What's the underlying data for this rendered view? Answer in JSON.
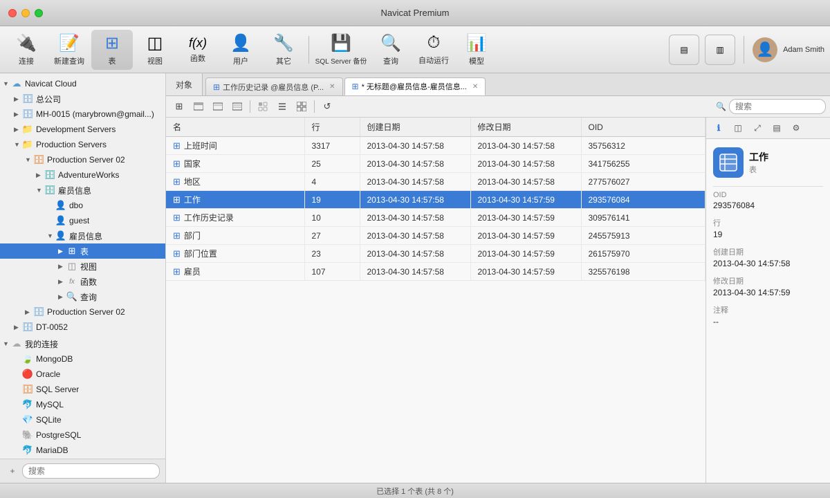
{
  "app": {
    "title": "Navicat Premium"
  },
  "toolbar": {
    "buttons": [
      {
        "id": "connect",
        "label": "连接",
        "icon": "🔌"
      },
      {
        "id": "new-query",
        "label": "新建查询",
        "icon": "📄"
      },
      {
        "id": "table",
        "label": "表",
        "icon": "⊞",
        "active": true
      },
      {
        "id": "view",
        "label": "视图",
        "icon": "◫"
      },
      {
        "id": "func",
        "label": "函数",
        "icon": "fx"
      },
      {
        "id": "user",
        "label": "用户",
        "icon": "👤"
      },
      {
        "id": "other",
        "label": "其它",
        "icon": "🔧"
      },
      {
        "id": "sqlserver-backup",
        "label": "SQL Server 备份",
        "icon": "💾"
      },
      {
        "id": "query",
        "label": "查询",
        "icon": "🔍"
      },
      {
        "id": "auto-run",
        "label": "自动运行",
        "icon": "⚡"
      },
      {
        "id": "model",
        "label": "模型",
        "icon": "📊"
      }
    ],
    "view_buttons": [
      {
        "id": "view1",
        "icon": "▤"
      },
      {
        "id": "view2",
        "icon": "▥"
      }
    ],
    "user": {
      "name": "Adam Smith",
      "avatar_bg": "#c0a080"
    }
  },
  "tabs_label": "对象",
  "tabs": [
    {
      "id": "tab-history",
      "label": "工作历史记录 @雇员信息 (P...",
      "icon": "⊞",
      "active": false,
      "closeable": true
    },
    {
      "id": "tab-untitled",
      "label": "* 无标题@雇员信息-雇员信息...",
      "icon": "⊞",
      "active": true,
      "closeable": true
    }
  ],
  "subtoolbar": {
    "buttons": [
      {
        "id": "btn-grid",
        "icon": "⊞"
      },
      {
        "id": "btn-add",
        "icon": "+"
      },
      {
        "id": "btn-remove",
        "icon": "−"
      },
      {
        "id": "btn-edit",
        "icon": "✏"
      },
      {
        "id": "btn-form",
        "icon": "▦"
      },
      {
        "id": "btn-refresh2",
        "icon": "↺"
      },
      {
        "id": "btn-filter2",
        "icon": "⊟"
      }
    ],
    "refresh_icon": "↺",
    "search_placeholder": "搜索"
  },
  "table": {
    "columns": [
      {
        "id": "name",
        "label": "名"
      },
      {
        "id": "rows",
        "label": "行"
      },
      {
        "id": "created",
        "label": "创建日期"
      },
      {
        "id": "modified",
        "label": "修改日期"
      },
      {
        "id": "oid",
        "label": "OID"
      }
    ],
    "rows": [
      {
        "name": "上班时间",
        "rows": "3317",
        "created": "2013-04-30 14:57:58",
        "modified": "2013-04-30 14:57:58",
        "oid": "35756312",
        "selected": false
      },
      {
        "name": "国家",
        "rows": "25",
        "created": "2013-04-30 14:57:58",
        "modified": "2013-04-30 14:57:58",
        "oid": "341756255",
        "selected": false
      },
      {
        "name": "地区",
        "rows": "4",
        "created": "2013-04-30 14:57:58",
        "modified": "2013-04-30 14:57:58",
        "oid": "277576027",
        "selected": false
      },
      {
        "name": "工作",
        "rows": "19",
        "created": "2013-04-30 14:57:58",
        "modified": "2013-04-30 14:57:59",
        "oid": "293576084",
        "selected": true
      },
      {
        "name": "工作历史记录",
        "rows": "10",
        "created": "2013-04-30 14:57:58",
        "modified": "2013-04-30 14:57:59",
        "oid": "309576141",
        "selected": false
      },
      {
        "name": "部门",
        "rows": "27",
        "created": "2013-04-30 14:57:58",
        "modified": "2013-04-30 14:57:59",
        "oid": "245575913",
        "selected": false
      },
      {
        "name": "部门位置",
        "rows": "23",
        "created": "2013-04-30 14:57:58",
        "modified": "2013-04-30 14:57:59",
        "oid": "261575970",
        "selected": false
      },
      {
        "name": "雇员",
        "rows": "107",
        "created": "2013-04-30 14:57:58",
        "modified": "2013-04-30 14:57:59",
        "oid": "325576198",
        "selected": false
      }
    ]
  },
  "right_panel": {
    "tabs": [
      {
        "id": "info",
        "label": "ℹ",
        "active": true
      },
      {
        "id": "preview",
        "label": "◫"
      },
      {
        "id": "expand",
        "label": "⤢"
      },
      {
        "id": "cols",
        "label": "▤"
      },
      {
        "id": "settings",
        "label": "⚙"
      }
    ],
    "object": {
      "name": "工作",
      "type": "表"
    },
    "fields": [
      {
        "label": "OID",
        "value": "293576084"
      },
      {
        "label": "行",
        "value": "19"
      },
      {
        "label": "创建日期",
        "value": "2013-04-30 14:57:58"
      },
      {
        "label": "修改日期",
        "value": "2013-04-30 14:57:59"
      },
      {
        "label": "注释",
        "value": "--"
      }
    ]
  },
  "sidebar": {
    "search_placeholder": "搜索",
    "tree": [
      {
        "id": "navicat-cloud",
        "label": "Navicat Cloud",
        "icon": "cloud",
        "level": 0,
        "expanded": true,
        "arrow": "open"
      },
      {
        "id": "corp",
        "label": "总公司",
        "icon": "db",
        "level": 1,
        "expanded": false,
        "arrow": "closed"
      },
      {
        "id": "mh-0015",
        "label": "MH-0015 (marybrown@gmail...)",
        "icon": "db",
        "level": 1,
        "expanded": false,
        "arrow": "closed"
      },
      {
        "id": "dev-servers",
        "label": "Development Servers",
        "icon": "folder",
        "level": 1,
        "expanded": false,
        "arrow": "closed"
      },
      {
        "id": "prod-servers",
        "label": "Production Servers",
        "icon": "folder",
        "level": 1,
        "expanded": true,
        "arrow": "open"
      },
      {
        "id": "prod-server-02",
        "label": "Production Server 02",
        "icon": "db-orange",
        "level": 2,
        "expanded": true,
        "arrow": "open"
      },
      {
        "id": "adventure-works",
        "label": "AdventureWorks",
        "icon": "db-cyan",
        "level": 3,
        "expanded": false,
        "arrow": "closed"
      },
      {
        "id": "employee-info",
        "label": "雇员信息",
        "icon": "db-cyan",
        "level": 3,
        "expanded": true,
        "arrow": "open"
      },
      {
        "id": "dbo",
        "label": "dbo",
        "icon": "user-schema",
        "level": 4,
        "expanded": false,
        "arrow": "none"
      },
      {
        "id": "guest",
        "label": "guest",
        "icon": "user-schema",
        "level": 4,
        "expanded": false,
        "arrow": "none"
      },
      {
        "id": "employee-info-schema",
        "label": "雇员信息",
        "icon": "user-schema",
        "level": 4,
        "expanded": true,
        "arrow": "open"
      },
      {
        "id": "tables",
        "label": "表",
        "icon": "table",
        "level": 5,
        "expanded": false,
        "arrow": "closed",
        "selected": true
      },
      {
        "id": "views",
        "label": "视图",
        "icon": "view",
        "level": 5,
        "expanded": false,
        "arrow": "closed"
      },
      {
        "id": "functions",
        "label": "函数",
        "icon": "func",
        "level": 5,
        "expanded": false,
        "arrow": "closed"
      },
      {
        "id": "queries",
        "label": "查询",
        "icon": "query",
        "level": 5,
        "expanded": false,
        "arrow": "closed"
      },
      {
        "id": "prod-server-02b",
        "label": "Production Server 02",
        "icon": "db-blue",
        "level": 2,
        "expanded": false,
        "arrow": "closed"
      },
      {
        "id": "dt-0052",
        "label": "DT-0052",
        "icon": "db-blue",
        "level": 1,
        "expanded": false,
        "arrow": "closed"
      },
      {
        "id": "my-connections",
        "label": "我的连接",
        "icon": "cloud-gray",
        "level": 0,
        "expanded": true,
        "arrow": "open"
      },
      {
        "id": "mongodb",
        "label": "MongoDB",
        "icon": "mongo",
        "level": 1,
        "expanded": false,
        "arrow": "none"
      },
      {
        "id": "oracle",
        "label": "Oracle",
        "icon": "oracle",
        "level": 1,
        "expanded": false,
        "arrow": "none"
      },
      {
        "id": "sql-server",
        "label": "SQL Server",
        "icon": "sqlserver",
        "level": 1,
        "expanded": false,
        "arrow": "none"
      },
      {
        "id": "mysql",
        "label": "MySQL",
        "icon": "mysql",
        "level": 1,
        "expanded": false,
        "arrow": "none"
      },
      {
        "id": "sqlite",
        "label": "SQLite",
        "icon": "sqlite",
        "level": 1,
        "expanded": false,
        "arrow": "none"
      },
      {
        "id": "postgresql",
        "label": "PostgreSQL",
        "icon": "postgresql",
        "level": 1,
        "expanded": false,
        "arrow": "none"
      },
      {
        "id": "mariadb",
        "label": "MariaDB",
        "icon": "mariadb",
        "level": 1,
        "expanded": false,
        "arrow": "none"
      }
    ]
  },
  "statusbar": {
    "text": "已选择 1 个表 (共 8 个)"
  }
}
